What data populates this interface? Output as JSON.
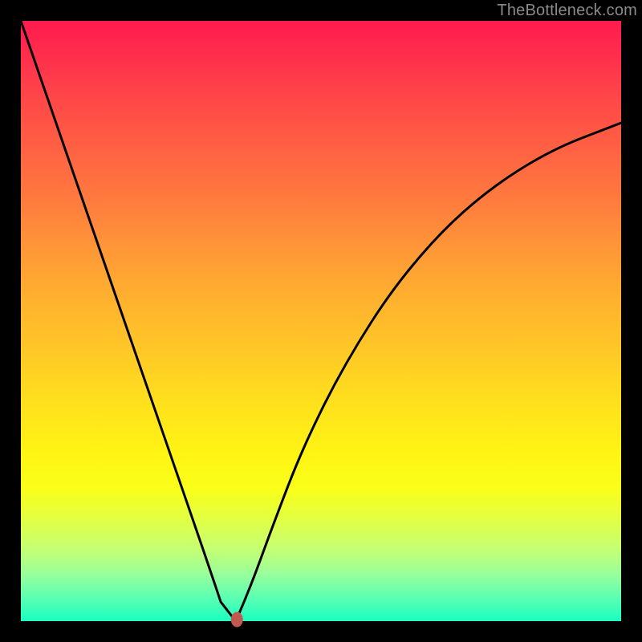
{
  "watermark": "TheBottleneck.com",
  "chart_data": {
    "type": "line",
    "title": "",
    "xlabel": "",
    "ylabel": "",
    "xlim": [
      0,
      1
    ],
    "ylim": [
      0,
      1
    ],
    "series": [
      {
        "name": "curve",
        "x": [
          0.0,
          0.05,
          0.1,
          0.15,
          0.2,
          0.25,
          0.29,
          0.315,
          0.333,
          0.35,
          0.358,
          0.38,
          0.42,
          0.47,
          0.54,
          0.63,
          0.74,
          0.87,
          1.0
        ],
        "y": [
          1.0,
          0.855,
          0.71,
          0.565,
          0.42,
          0.275,
          0.159,
          0.086,
          0.032,
          0.0,
          0.0,
          0.05,
          0.16,
          0.29,
          0.43,
          0.57,
          0.69,
          0.78,
          0.83
        ]
      }
    ],
    "flat_bottom": {
      "x_start": 0.333,
      "x_end": 0.358,
      "y": 0.0
    },
    "marker": {
      "x": 0.36,
      "y": 0.0
    },
    "colors": {
      "curve_stroke": "#000000",
      "marker_fill": "#c15a4e",
      "frame": "#000000"
    }
  }
}
